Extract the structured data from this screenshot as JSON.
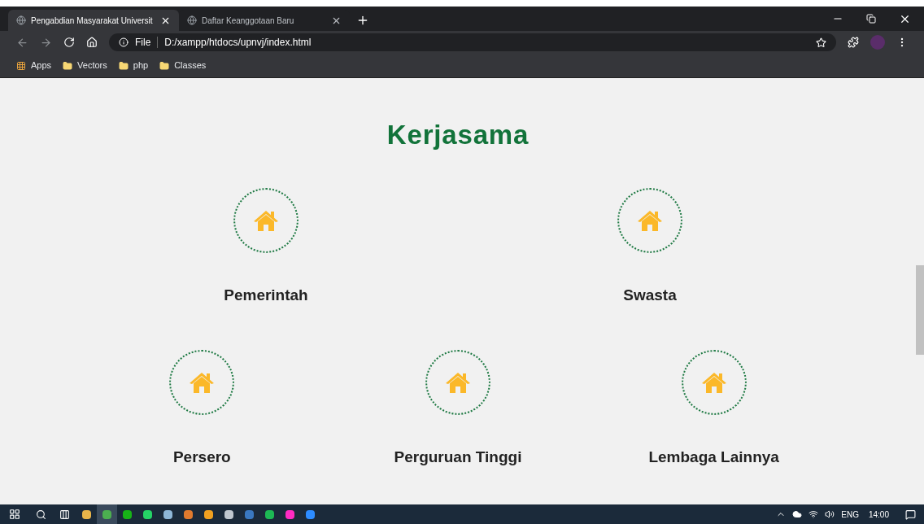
{
  "tabs": [
    {
      "title": "Pengabdian Masyarakat Universit",
      "selected": true
    },
    {
      "title": "Daftar Keanggotaan Baru",
      "selected": false
    }
  ],
  "address": {
    "scheme": "File",
    "url": "D:/xampp/htdocs/upnvj/index.html"
  },
  "bookmarks": [
    {
      "label": "Apps",
      "kind": "apps"
    },
    {
      "label": "Vectors",
      "kind": "folder"
    },
    {
      "label": "php",
      "kind": "folder"
    },
    {
      "label": "Classes",
      "kind": "folder"
    }
  ],
  "page": {
    "heading": "Kerjasama",
    "rows": [
      [
        {
          "label": "Pemerintah"
        },
        {
          "label": "Swasta"
        }
      ],
      [
        {
          "label": "Persero"
        },
        {
          "label": "Perguruan Tinggi"
        },
        {
          "label": "Lembaga Lainnya"
        }
      ]
    ]
  },
  "taskbar": {
    "apps": [
      {
        "color": "#e8b44a",
        "selected": false
      },
      {
        "color": "#4caf50",
        "selected": true
      },
      {
        "color": "#17b317",
        "selected": false
      },
      {
        "color": "#25d366",
        "selected": false
      },
      {
        "color": "#8fb8d8",
        "selected": false
      },
      {
        "color": "#e07a2e",
        "selected": false
      },
      {
        "color": "#f0a020",
        "selected": false
      },
      {
        "color": "#c0c8d0",
        "selected": false
      },
      {
        "color": "#3a78c0",
        "selected": false
      },
      {
        "color": "#1db954",
        "selected": false
      },
      {
        "color": "#ff2bc2",
        "selected": false
      },
      {
        "color": "#2d8cff",
        "selected": false
      }
    ],
    "language": "ENG",
    "time": "14:00"
  }
}
